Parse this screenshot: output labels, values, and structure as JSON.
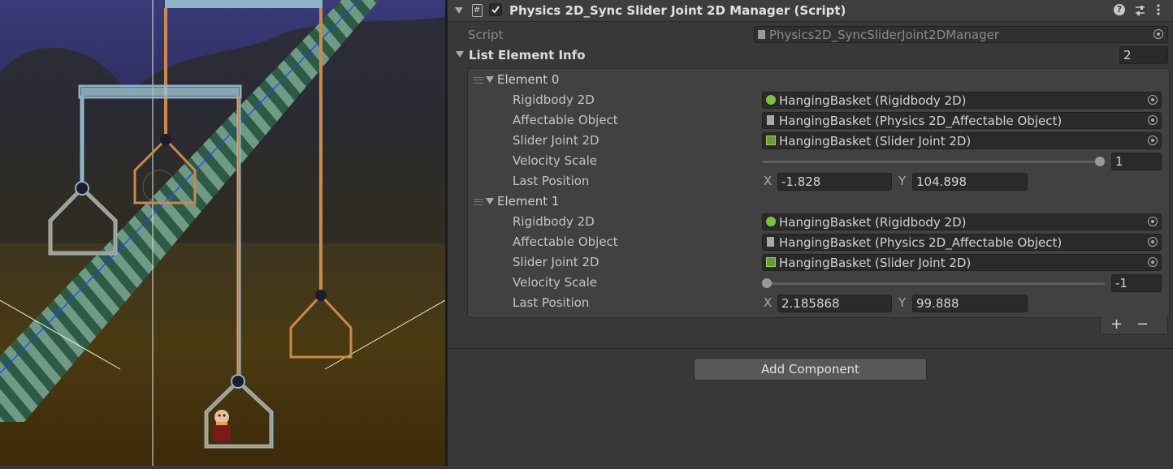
{
  "component": {
    "title": "Physics 2D_Sync Slider Joint 2D Manager (Script)",
    "enabled": true
  },
  "script_field": {
    "label": "Script",
    "value": "Physics2D_SyncSliderJoint2DManager"
  },
  "list": {
    "label": "List Element Info",
    "size": "2",
    "elements": [
      {
        "title": "Element 0",
        "rigidbody_label": "Rigidbody 2D",
        "rigidbody_value": "HangingBasket (Rigidbody 2D)",
        "affectable_label": "Affectable Object",
        "affectable_value": "HangingBasket (Physics 2D_Affectable Object)",
        "slider_label": "Slider Joint 2D",
        "slider_value": "HangingBasket (Slider Joint 2D)",
        "velocity_label": "Velocity Scale",
        "velocity_value": "1",
        "velocity_fraction": 1.0,
        "position_label": "Last Position",
        "x_label": "X",
        "x_value": "-1.828",
        "y_label": "Y",
        "y_value": "104.898"
      },
      {
        "title": "Element 1",
        "rigidbody_label": "Rigidbody 2D",
        "rigidbody_value": "HangingBasket (Rigidbody 2D)",
        "affectable_label": "Affectable Object",
        "affectable_value": "HangingBasket (Physics 2D_Affectable Object)",
        "slider_label": "Slider Joint 2D",
        "slider_value": "HangingBasket (Slider Joint 2D)",
        "velocity_label": "Velocity Scale",
        "velocity_value": "-1",
        "velocity_fraction": 0.0,
        "position_label": "Last Position",
        "x_label": "X",
        "x_value": "2.185868",
        "y_label": "Y",
        "y_value": "99.888"
      }
    ],
    "add_symbol": "+",
    "remove_symbol": "−"
  },
  "add_component_label": "Add Component",
  "colors": {
    "rope": "#c98a4b",
    "frame": "#8fb3c7",
    "tube_dark": "#2e5a45",
    "tube_light": "#6f9a85",
    "joint_line": "#1f3fff"
  }
}
